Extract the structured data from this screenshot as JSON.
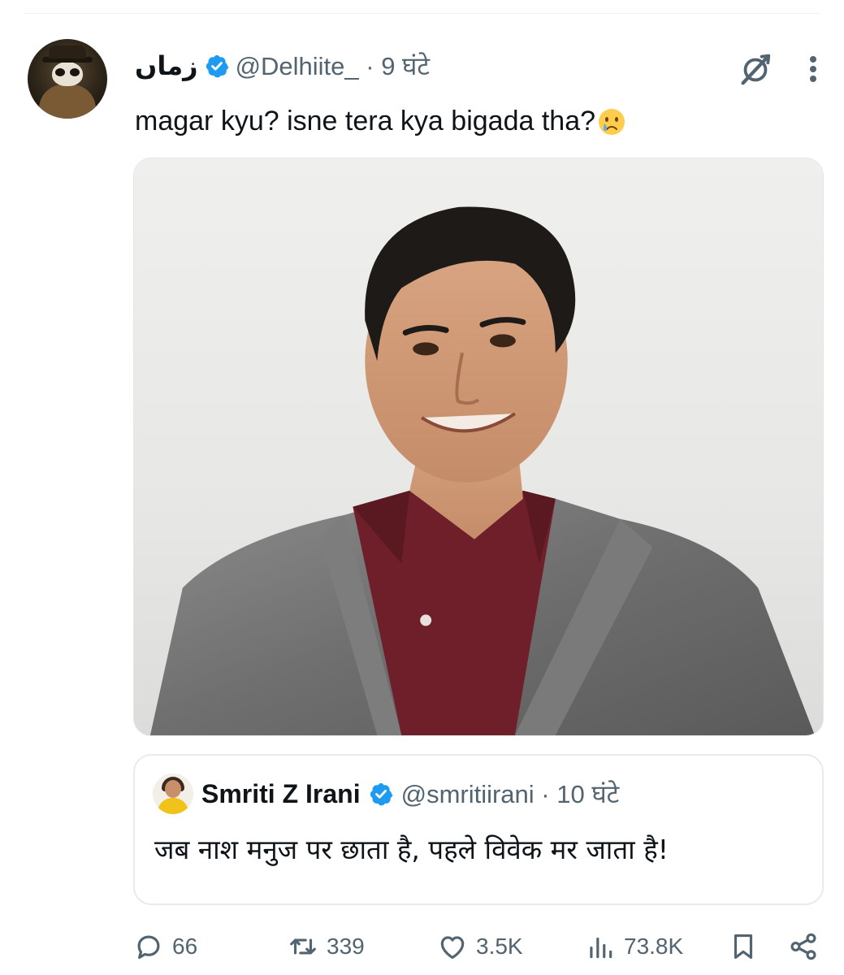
{
  "tweet": {
    "display_name": "زماں",
    "handle_time": "@Delhiite_ · 9 घंटे",
    "text": "magar kyu? isne tera kya bigada tha?",
    "emoji_icon": "crying-face-emoji"
  },
  "quoted": {
    "name": "Smriti Z Irani",
    "handle_time": "@smritiirani · 10 घंटे",
    "text": "जब नाश मनुज पर छाता है, पहले विवेक मर जाता है!"
  },
  "actions": {
    "reply_count": "66",
    "retweet_count": "339",
    "like_count": "3.5K",
    "view_count": "73.8K"
  },
  "colors": {
    "verified": "#1d9bf0",
    "muted": "#536471",
    "text": "#0f1419"
  },
  "icons": [
    "grok-icon",
    "more-icon",
    "verified-badge-icon",
    "reply-icon",
    "retweet-icon",
    "like-icon",
    "views-icon",
    "bookmark-icon",
    "share-icon"
  ]
}
